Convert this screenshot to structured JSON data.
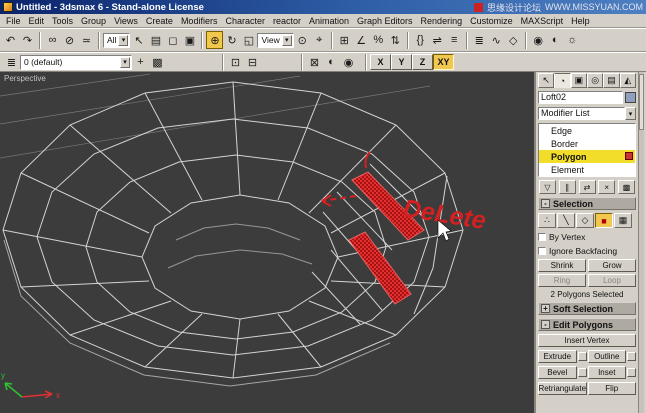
{
  "window": {
    "title": "Untitled - 3dsmax 6 - Stand-alone License",
    "watermark_cn": "思缘设计论坛",
    "watermark_url": "WWW.MISSYUAN.COM"
  },
  "menu": {
    "items": [
      "File",
      "Edit",
      "Tools",
      "Group",
      "Views",
      "Create",
      "Modifiers",
      "Character",
      "reactor",
      "Animation",
      "Graph Editors",
      "Rendering",
      "Customize",
      "MAXScript",
      "Help"
    ]
  },
  "toolbar": {
    "selection_filter": "All",
    "coord_system": "View",
    "axis_x": "X",
    "axis_y": "Y",
    "axis_z": "Z",
    "axis_xy": "XY"
  },
  "layerbar": {
    "layer_name": "0 (default)"
  },
  "viewport": {
    "label": "Perspective",
    "annotation": "DeLete",
    "axis_label_x": "x",
    "axis_label_y": "y"
  },
  "icons": {
    "undo": "↶",
    "redo": "↷",
    "link": "∞",
    "unlink": "⊘",
    "bind": "≃",
    "dropdown_arrow": "▾",
    "select": "↖",
    "select_by_name": "▤",
    "region": "◻",
    "crossing": "▣",
    "move": "⊕",
    "rotate": "↻",
    "scale": "◱",
    "pivot": "⊙",
    "manipulate": "⌖",
    "snap": "⊞",
    "angle_snap": "∠",
    "percent_snap": "%",
    "spinner_snap": "⇅",
    "named_sets": "{}",
    "mirror": "⇌",
    "align": "≡",
    "layers": "≣",
    "curve_editor": "∿",
    "schematic": "◇",
    "material": "◉",
    "render_scene": "◐",
    "quick_render": "☼",
    "new_layer": "+",
    "extra1": "⊡",
    "extra2": "⊟",
    "extra3": "⊠",
    "tab_create": "↖",
    "tab_modify": "◔",
    "tab_hierarchy": "▣",
    "tab_motion": "◎",
    "tab_display": "▤",
    "tab_utilities": "◭",
    "pin_stack": "▽",
    "show_end": "∥",
    "make_unique": "⇄",
    "remove_mod": "×",
    "configure": "▩",
    "sel_vertex": "∴",
    "sel_edge": "╲",
    "sel_border": "◇",
    "sel_polygon": "■",
    "sel_element": "▦",
    "minus": "-",
    "plus": "+"
  },
  "panel": {
    "object_name": "Loft02",
    "modifier_list": "Modifier List",
    "stack": {
      "row0": "Edge",
      "row1": "Border",
      "row2": "Polygon",
      "row3": "Element"
    },
    "selection": {
      "title": "Selection",
      "by_vertex": "By Vertex",
      "ignore_backfacing": "Ignore Backfacing",
      "shrink": "Shrink",
      "grow": "Grow",
      "ring": "Ring",
      "loop": "Loop",
      "status": "2 Polygons Selected"
    },
    "soft_selection": {
      "title": "Soft Selection"
    },
    "edit_polygons": {
      "title": "Edit Polygons",
      "insert_vertex": "Insert Vertex",
      "extrude": "Extrude",
      "outline": "Outline",
      "bevel": "Bevel",
      "inset": "Inset",
      "retriangulate": "Retriangulate",
      "flip": "Flip"
    }
  }
}
